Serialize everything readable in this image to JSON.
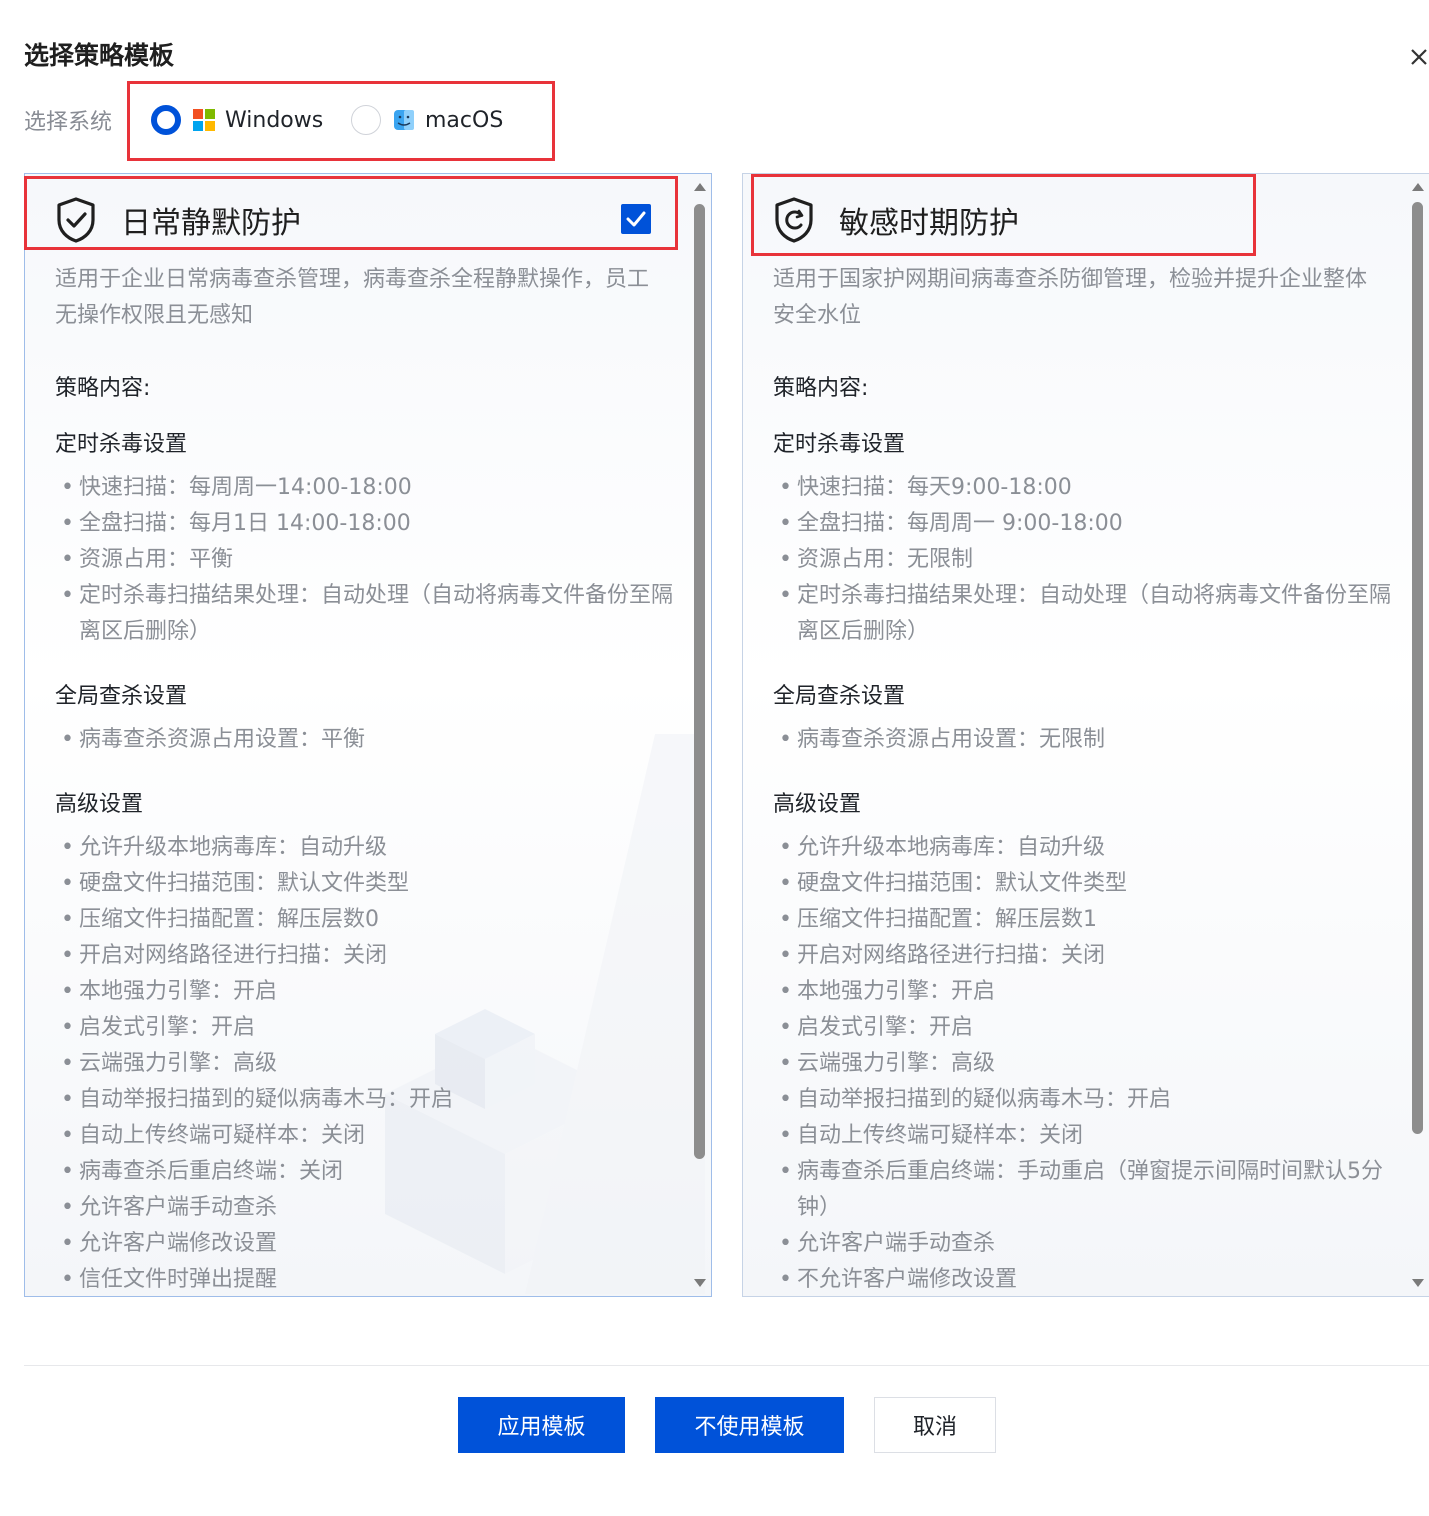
{
  "dialog": {
    "title": "选择策略模板",
    "close_icon": "close-icon"
  },
  "system_select": {
    "label": "选择系统",
    "options": [
      {
        "label": "Windows",
        "icon": "windows-logo-icon",
        "checked": true
      },
      {
        "label": "macOS",
        "icon": "macos-finder-icon",
        "checked": false
      }
    ]
  },
  "templates": [
    {
      "title": "日常静默防护",
      "icon": "shield-check-icon",
      "selected": true,
      "description": "适用于企业日常病毒查杀管理，病毒查杀全程静默操作，员工无操作权限且无感知",
      "content_label": "策略内容:",
      "sections": [
        {
          "title": "定时杀毒设置",
          "items": [
            "快速扫描：每周周一14:00-18:00",
            "全盘扫描：每月1日 14:00-18:00",
            "资源占用：平衡",
            "定时杀毒扫描结果处理：自动处理（自动将病毒文件备份至隔离区后删除）"
          ]
        },
        {
          "title": "全局查杀设置",
          "items": [
            "病毒查杀资源占用设置：平衡"
          ]
        },
        {
          "title": "高级设置",
          "items": [
            "允许升级本地病毒库：自动升级",
            "硬盘文件扫描范围：默认文件类型",
            "压缩文件扫描配置：解压层数0",
            "开启对网络路径进行扫描：关闭",
            "本地强力引擎：开启",
            "启发式引擎：开启",
            "云端强力引擎：高级",
            "自动举报扫描到的疑似病毒木马：开启",
            "自动上传终端可疑样本：关闭",
            "病毒查杀后重启终端：关闭",
            "允许客户端手动查杀",
            "允许客户端修改设置",
            "信任文件时弹出提醒"
          ]
        }
      ]
    },
    {
      "title": "敏感时期防护",
      "icon": "shield-refresh-icon",
      "selected": false,
      "description": "适用于国家护网期间病毒查杀防御管理，检验并提升企业整体安全水位",
      "content_label": "策略内容:",
      "sections": [
        {
          "title": "定时杀毒设置",
          "items": [
            "快速扫描：每天9:00-18:00",
            "全盘扫描：每周周一 9:00-18:00",
            "资源占用：无限制",
            "定时杀毒扫描结果处理：自动处理（自动将病毒文件备份至隔离区后删除）"
          ]
        },
        {
          "title": "全局查杀设置",
          "items": [
            "病毒查杀资源占用设置：无限制"
          ]
        },
        {
          "title": "高级设置",
          "items": [
            "允许升级本地病毒库：自动升级",
            "硬盘文件扫描范围：默认文件类型",
            "压缩文件扫描配置：解压层数1",
            "开启对网络路径进行扫描：关闭",
            "本地强力引擎：开启",
            "启发式引擎：开启",
            "云端强力引擎：高级",
            "自动举报扫描到的疑似病毒木马：开启",
            "自动上传终端可疑样本：关闭",
            "病毒查杀后重启终端：手动重启（弹窗提示间隔时间默认5分钟）",
            "允许客户端手动查杀",
            "不允许客户端修改设置"
          ]
        }
      ]
    }
  ],
  "footer": {
    "apply_label": "应用模板",
    "no_template_label": "不使用模板",
    "cancel_label": "取消"
  },
  "colors": {
    "primary": "#0052d9",
    "highlight": "#e8333a"
  }
}
